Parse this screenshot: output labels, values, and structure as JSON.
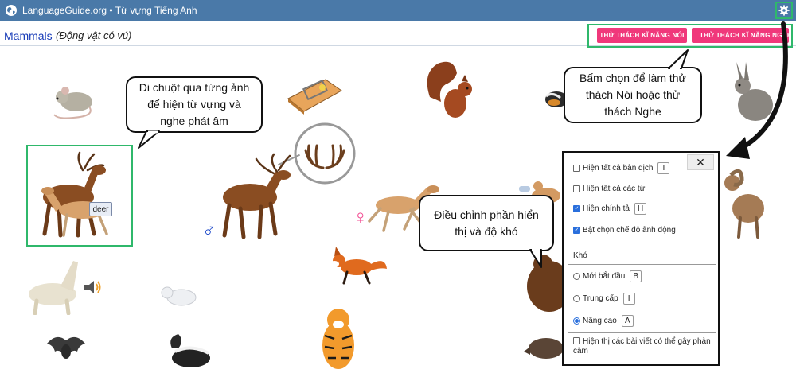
{
  "topbar": {
    "title": "LanguageGuide.org • Từ vựng Tiếng Anh"
  },
  "header": {
    "title": "Mammals",
    "subtitle": "(Động vật có vú)"
  },
  "challenge": {
    "speaking_label": "THỬ THÁCH KĨ NĂNG NÓI",
    "listening_label": "THỬ THÁCH KĨ NĂNG NGHE"
  },
  "gallery": {
    "hover_label": "deer",
    "male_symbol": "♂",
    "female_symbol": "♀"
  },
  "bubbles": {
    "hover_tip": "Di chuột qua từng ảnh để hiện từ vựng và nghe phát âm",
    "challenge_tip": "Bấm chọn để làm thử thách Nói hoặc thử thách Nghe",
    "display_tip": "Điều chỉnh phần hiển thị và độ khó"
  },
  "settings": {
    "close_label": "✕",
    "options": [
      {
        "label": "Hiện tất cả bản dịch",
        "key": "T",
        "checked": false
      },
      {
        "label": "Hiện tất cả các từ",
        "key": "",
        "checked": false
      },
      {
        "label": "Hiện chính tả",
        "key": "H",
        "checked": true
      },
      {
        "label": "Bật chọn chế độ ảnh động",
        "key": "",
        "checked": true
      }
    ],
    "difficulty_label": "Khó",
    "levels": [
      {
        "label": "Mới bắt đầu",
        "key": "B",
        "selected": false
      },
      {
        "label": "Trung cấp",
        "key": "I",
        "selected": false
      },
      {
        "label": "Nâng cao",
        "key": "A",
        "selected": true
      }
    ],
    "sensitive_label": "Hiện thị các bài viết có thể gây phản cảm"
  },
  "colors": {
    "topbar": "#4a79a8",
    "highlight": "#2fb86b",
    "challenge_button": "#f0387b",
    "title": "#1a3db8"
  }
}
